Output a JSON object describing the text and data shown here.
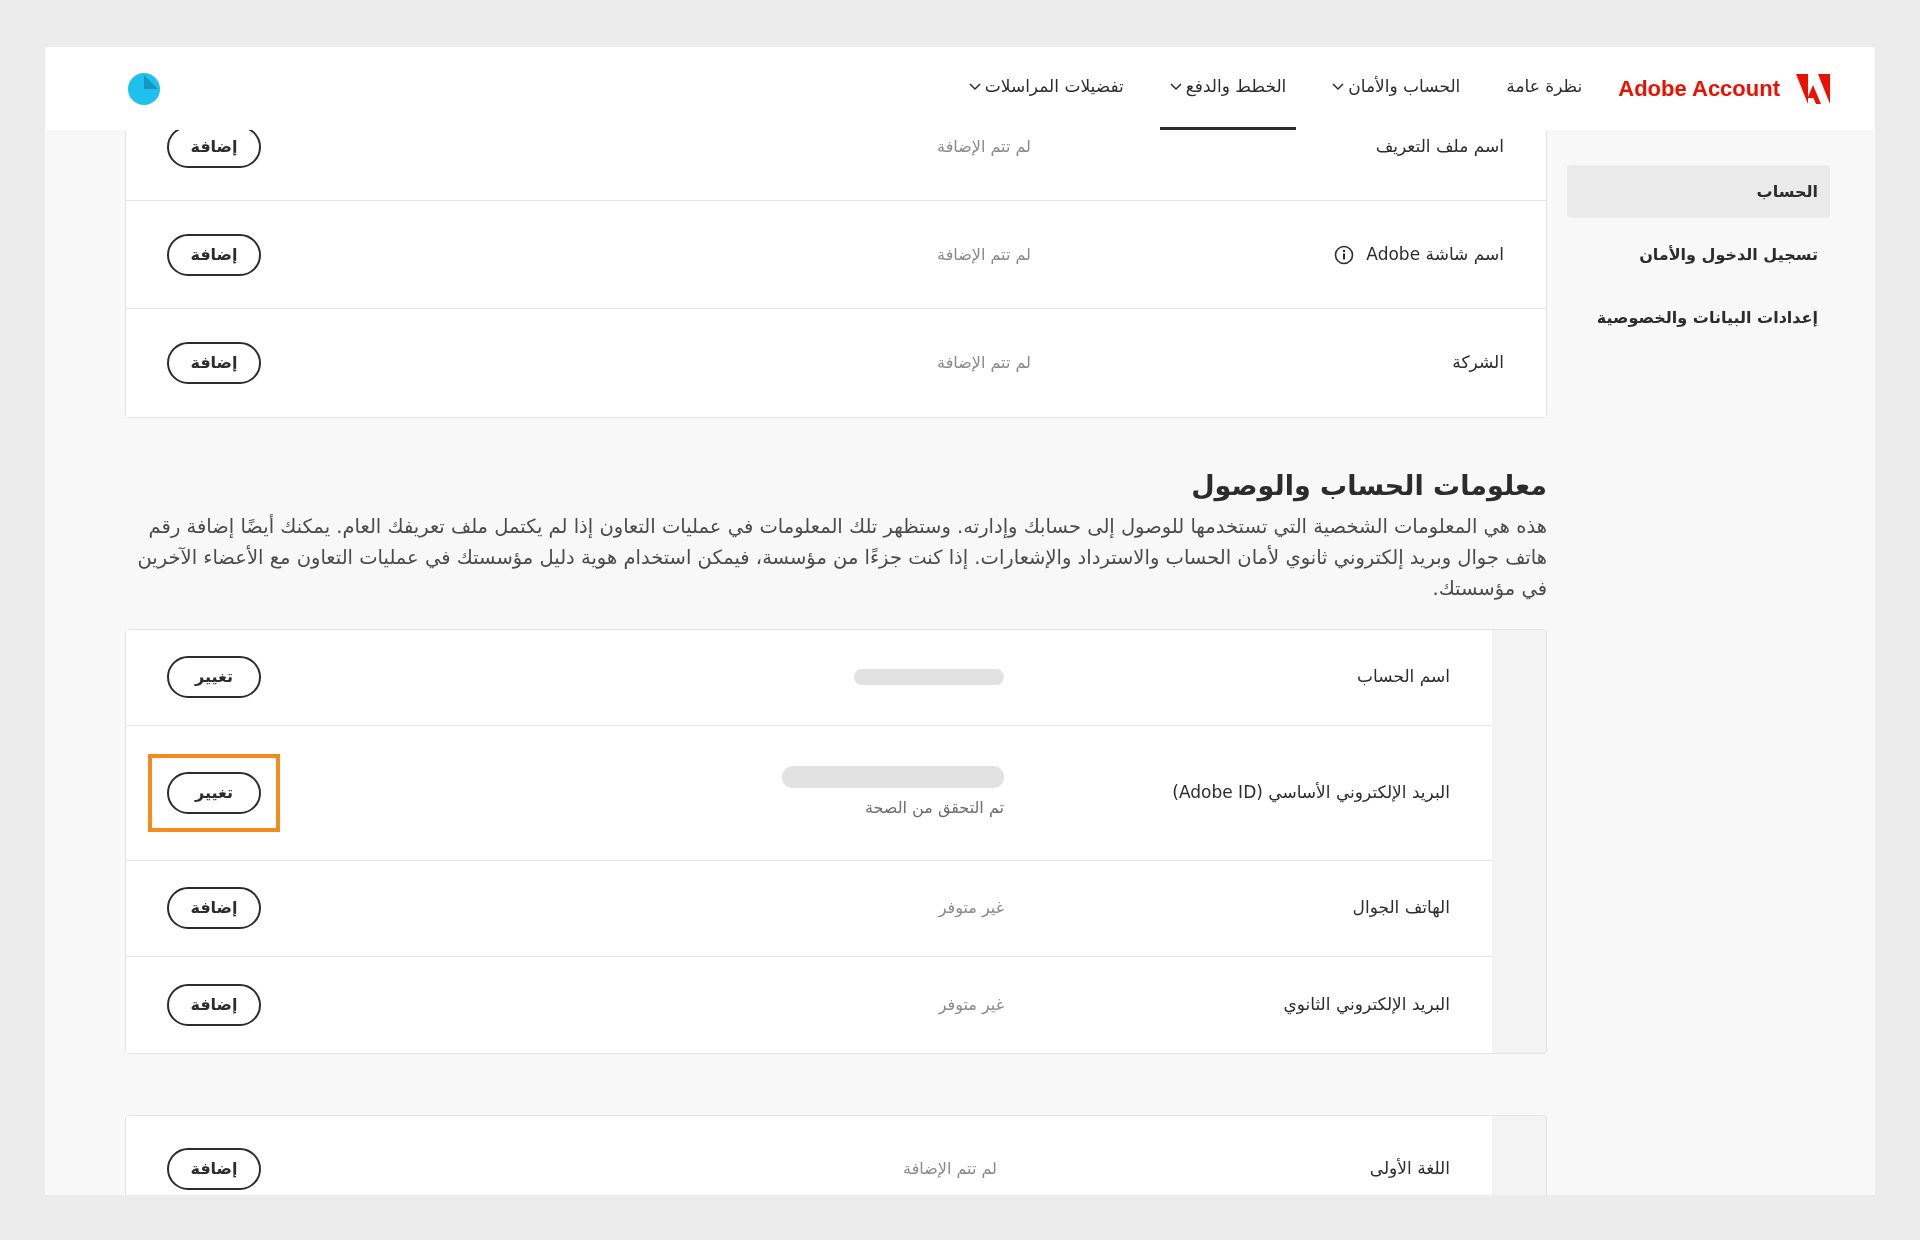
{
  "header": {
    "brand": "Adobe Account",
    "nav": [
      {
        "label": "نظرة عامة",
        "dropdown": false,
        "selected": false
      },
      {
        "label": "الحساب والأمان",
        "dropdown": true,
        "selected": false
      },
      {
        "label": "الخطط والدفع",
        "dropdown": true,
        "selected": true
      },
      {
        "label": "تفضيلات المراسلات",
        "dropdown": true,
        "selected": false
      }
    ]
  },
  "sidebar": {
    "items": [
      {
        "label": "الحساب",
        "selected": true
      },
      {
        "label": "تسجيل الدخول والأمان",
        "selected": false
      },
      {
        "label": "إعدادات البيانات والخصوصية",
        "selected": false
      }
    ]
  },
  "profile_card": {
    "rows": [
      {
        "label": "اسم ملف التعريف",
        "info_icon": false,
        "value": {
          "kind": "text",
          "text": "لم تتم الإضافة"
        },
        "button": "إضافة",
        "highlighted": false
      },
      {
        "label": "اسم شاشة Adobe",
        "info_icon": true,
        "value": {
          "kind": "text",
          "text": "لم تتم الإضافة"
        },
        "button": "إضافة",
        "highlighted": false
      },
      {
        "label": "الشركة",
        "info_icon": false,
        "value": {
          "kind": "text",
          "text": "لم تتم الإضافة"
        },
        "button": "إضافة",
        "highlighted": false
      }
    ]
  },
  "access_section": {
    "title": "معلومات الحساب والوصول",
    "description": "هذه هي المعلومات الشخصية التي تستخدمها للوصول إلى حسابك وإدارته. وستظهر تلك المعلومات في عمليات التعاون إذا لم يكتمل ملف تعريفك العام. يمكنك أيضًا إضافة رقم هاتف جوال وبريد إلكتروني ثانوي لأمان الحساب والاسترداد والإشعارات. إذا كنت جزءًا من مؤسسة، فيمكن استخدام هوية دليل مؤسستك في عمليات التعاون مع الأعضاء الآخرين في مؤسستك.",
    "rows": [
      {
        "label": "اسم الحساب",
        "info_icon": false,
        "value": {
          "kind": "redacted"
        },
        "button": "تغيير",
        "highlighted": false
      },
      {
        "label": "البريد الإلكتروني الأساسي (Adobe ID)",
        "info_icon": false,
        "value": {
          "kind": "redacted",
          "note": "تم التحقق من الصحة"
        },
        "button": "تغيير",
        "highlighted": true
      },
      {
        "label": "الهاتف الجوال",
        "info_icon": false,
        "value": {
          "kind": "text",
          "text": "غير متوفر"
        },
        "button": "إضافة",
        "highlighted": false
      },
      {
        "label": "البريد الإلكتروني الثانوي",
        "info_icon": false,
        "value": {
          "kind": "text",
          "text": "غير متوفر"
        },
        "button": "إضافة",
        "highlighted": false
      }
    ]
  },
  "language_card": {
    "rows": [
      {
        "label": "اللغة الأولى",
        "info_icon": false,
        "value": {
          "kind": "text",
          "text": "لم تتم الإضافة"
        },
        "button": "إضافة",
        "highlighted": false
      }
    ]
  }
}
